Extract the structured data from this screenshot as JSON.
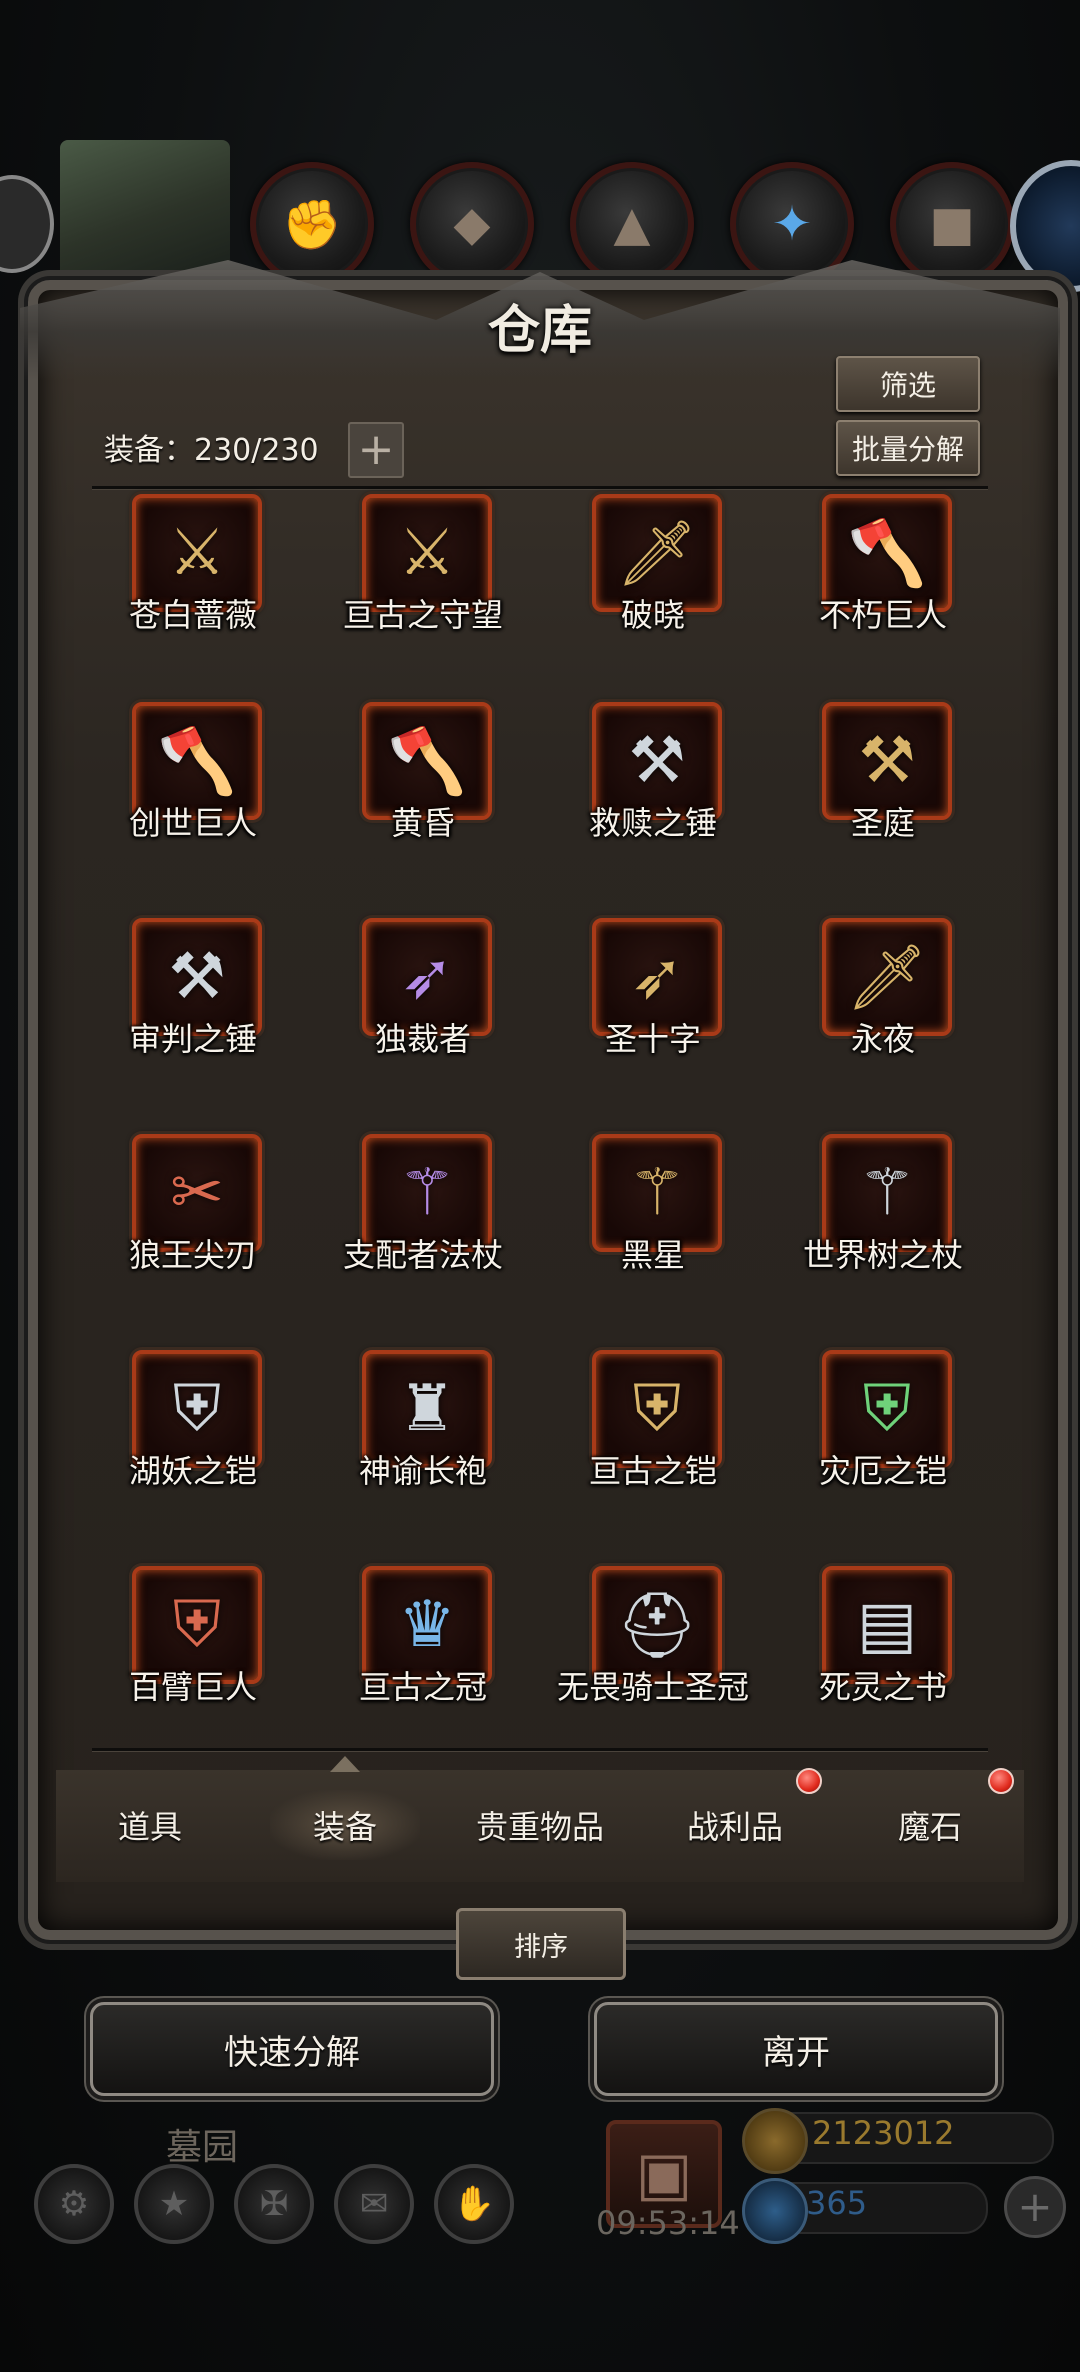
{
  "window": {
    "title": "仓库"
  },
  "header": {
    "capacity_label": "装备：230/230",
    "expand_icon": "plus-icon",
    "filter_label": "筛选",
    "batch_decompose_label": "批量分解"
  },
  "items": [
    {
      "name": "苍白蔷薇",
      "icon": "sword-icon",
      "tier": "gold"
    },
    {
      "name": "亘古之守望",
      "icon": "sword-icon",
      "tier": "gold"
    },
    {
      "name": "破晓",
      "icon": "dagger-icon",
      "tier": "gold"
    },
    {
      "name": "不朽巨人",
      "icon": "axe-icon",
      "tier": "purple"
    },
    {
      "name": "创世巨人",
      "icon": "axe-icon",
      "tier": "purple"
    },
    {
      "name": "黄昏",
      "icon": "axe-icon",
      "tier": "gold"
    },
    {
      "name": "救赎之锤",
      "icon": "hammer-icon",
      "tier": "silver"
    },
    {
      "name": "圣庭",
      "icon": "hammer-icon",
      "tier": "gold"
    },
    {
      "name": "审判之锤",
      "icon": "hammer-icon",
      "tier": "silver"
    },
    {
      "name": "独裁者",
      "icon": "gun-icon",
      "tier": "purple"
    },
    {
      "name": "圣十字",
      "icon": "gun-icon",
      "tier": "gold"
    },
    {
      "name": "永夜",
      "icon": "dagger-icon",
      "tier": "gold"
    },
    {
      "name": "狼王尖刃",
      "icon": "claw-icon",
      "tier": "red"
    },
    {
      "name": "支配者法杖",
      "icon": "staff-icon",
      "tier": "purple"
    },
    {
      "name": "黑星",
      "icon": "staff-icon",
      "tier": "gold"
    },
    {
      "name": "世界树之杖",
      "icon": "staff-icon",
      "tier": "silver"
    },
    {
      "name": "湖妖之铠",
      "icon": "armor-icon",
      "tier": "silver"
    },
    {
      "name": "神谕长袍",
      "icon": "robe-icon",
      "tier": "silver"
    },
    {
      "name": "亘古之铠",
      "icon": "armor-icon",
      "tier": "gold"
    },
    {
      "name": "灾厄之铠",
      "icon": "armor-icon",
      "tier": "green"
    },
    {
      "name": "百臂巨人",
      "icon": "armor-icon",
      "tier": "red"
    },
    {
      "name": "亘古之冠",
      "icon": "crown-icon",
      "tier": "blue"
    },
    {
      "name": "无畏骑士圣冠",
      "icon": "helmet-icon",
      "tier": "silver"
    },
    {
      "name": "死灵之书",
      "icon": "book-icon",
      "tier": "silver"
    }
  ],
  "tabs": [
    {
      "label": "道具",
      "active": false,
      "badge": false
    },
    {
      "label": "装备",
      "active": true,
      "badge": false
    },
    {
      "label": "贵重物品",
      "active": false,
      "badge": false
    },
    {
      "label": "战利品",
      "active": false,
      "badge": true
    },
    {
      "label": "魔石",
      "active": false,
      "badge": true
    }
  ],
  "sort_label": "排序",
  "actions": {
    "quick_decompose_label": "快速分解",
    "leave_label": "离开"
  },
  "hud": {
    "map_name": "墓园",
    "timer": "09:53:14",
    "gold": "2123012",
    "gems": "365",
    "gold_color": "#9a7a2e",
    "gem_color": "#2f5c8a"
  },
  "colors": {
    "frame_border": "#a93a18",
    "badge": "#e02a1d"
  }
}
